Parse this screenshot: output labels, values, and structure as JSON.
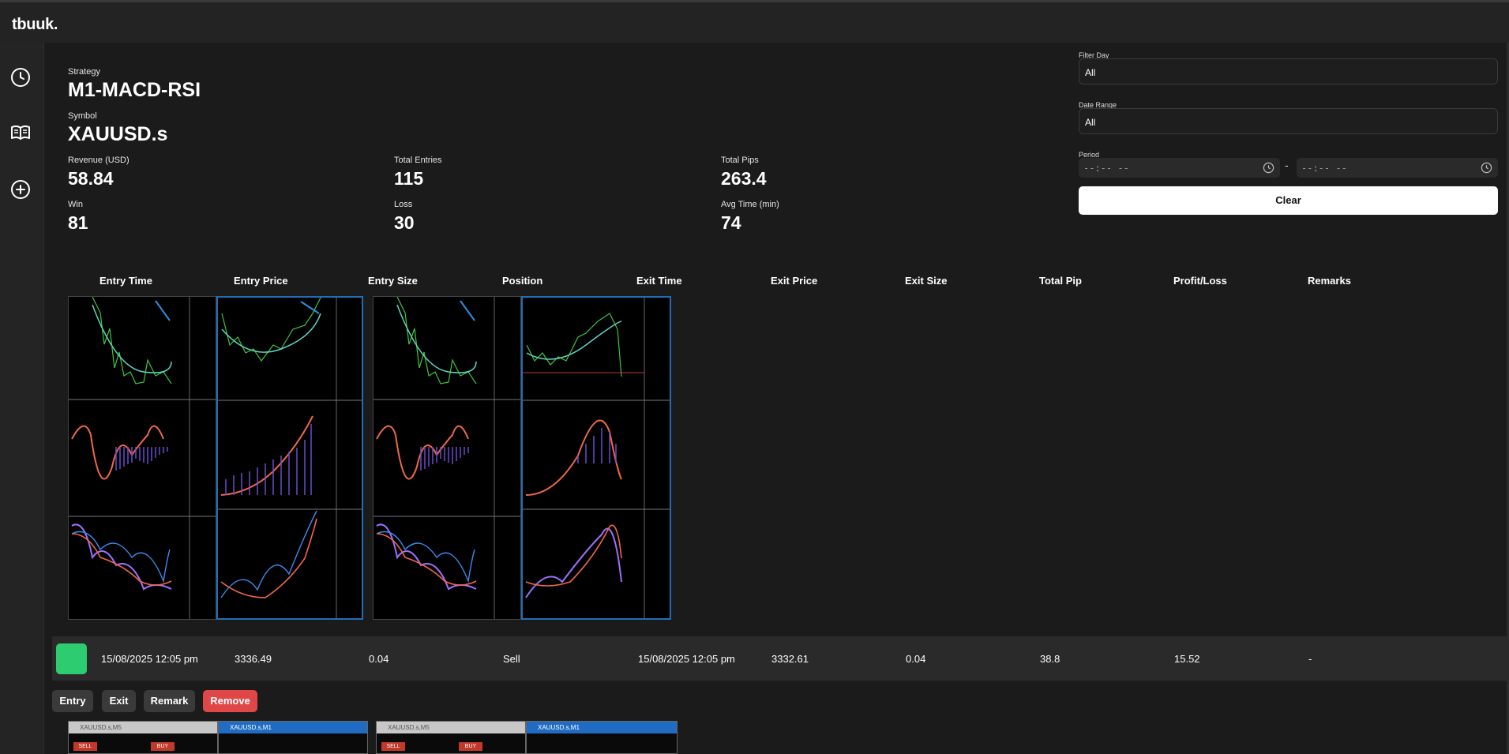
{
  "app": {
    "logo": "tbuuk."
  },
  "sidebar": {
    "items": [
      {
        "icon": "clock-icon"
      },
      {
        "icon": "book-icon"
      },
      {
        "icon": "add-circle-icon"
      }
    ]
  },
  "summary": {
    "strategy_label": "Strategy",
    "strategy": "M1-MACD-RSI",
    "symbol_label": "Symbol",
    "symbol": "XAUUSD.s",
    "stats": [
      {
        "label": "Revenue (USD)",
        "value": "58.84"
      },
      {
        "label": "Total Entries",
        "value": "115"
      },
      {
        "label": "Total Pips",
        "value": "263.4"
      },
      {
        "label": "Win",
        "value": "81"
      },
      {
        "label": "Loss",
        "value": "30"
      },
      {
        "label": "Avg Time (min)",
        "value": "74"
      }
    ]
  },
  "filters": {
    "filter_day_label": "Filter Day",
    "filter_day_value": "All",
    "date_range_label": "Date Range",
    "date_range_value": "All",
    "period_label": "Period",
    "period_start": "--:-- --",
    "period_separator": "-",
    "period_end": "--:-- --",
    "clear_label": "Clear"
  },
  "table": {
    "headers": [
      "Entry Time",
      "Entry Price",
      "Entry Size",
      "Position",
      "Exit Time",
      "Exit Price",
      "Exit Size",
      "Total Pip",
      "Profit/Loss",
      "Remarks"
    ],
    "row": {
      "status_color": "#2ecc71",
      "cells": [
        "15/08/2025 12:05 pm",
        "3336.49",
        "0.04",
        "Sell",
        "15/08/2025 12:05 pm",
        "3332.61",
        "0.04",
        "38.8",
        "15.52",
        "-"
      ]
    }
  },
  "actions": {
    "entry": "Entry",
    "exit": "Exit",
    "remark": "Remark",
    "remove": "Remove"
  },
  "next_screens": [
    {
      "title": "XAUUSD.s,M5",
      "sell": "SELL",
      "buy": "BUY"
    },
    {
      "title": "XAUUSD.s,M1",
      "sell": "",
      "buy": ""
    },
    {
      "title": "XAUUSD.s,M5",
      "sell": "SELL",
      "buy": "BUY"
    },
    {
      "title": "XAUUSD.s,M1",
      "sell": "",
      "buy": ""
    }
  ]
}
